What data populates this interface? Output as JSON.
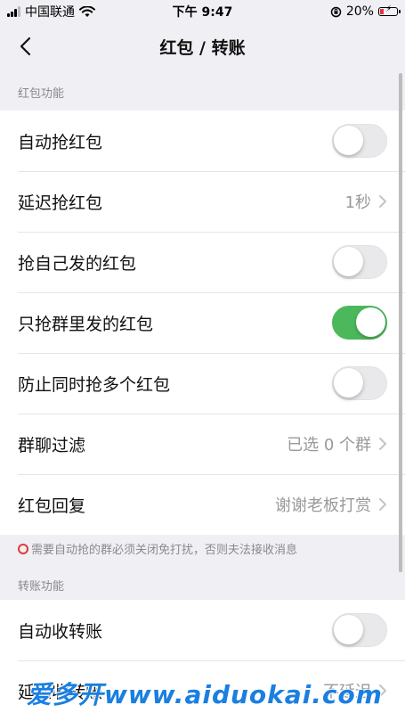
{
  "status_bar": {
    "carrier": "中国联通",
    "time": "下午 9:47",
    "battery": "20%"
  },
  "nav": {
    "title": "红包 / 转账"
  },
  "red_packet_section": {
    "label": "红包功能",
    "rows": [
      {
        "label": "自动抢红包",
        "type": "toggle",
        "on": false
      },
      {
        "label": "延迟抢红包",
        "type": "value",
        "value": "1秒"
      },
      {
        "label": "抢自己发的红包",
        "type": "toggle",
        "on": false
      },
      {
        "label": "只抢群里发的红包",
        "type": "toggle",
        "on": true
      },
      {
        "label": "防止同时抢多个红包",
        "type": "toggle",
        "on": false
      },
      {
        "label": "群聊过滤",
        "type": "value",
        "value": "已选 0 个群"
      },
      {
        "label": "红包回复",
        "type": "value",
        "value": "谢谢老板打赏"
      }
    ],
    "notice": "需要自动抢的群必须关闭免打扰，否则夫法接收消息"
  },
  "transfer_section": {
    "label": "转账功能",
    "rows": [
      {
        "label": "自动收转账",
        "type": "toggle",
        "on": false
      },
      {
        "label": "延迟收转账",
        "type": "value",
        "value": "不延迟"
      }
    ]
  },
  "watermark": "爱多开www.aiduokai.com",
  "colors": {
    "accent_green": "#4cb85c",
    "background": "#efeff4",
    "warning_red": "#e53935"
  }
}
